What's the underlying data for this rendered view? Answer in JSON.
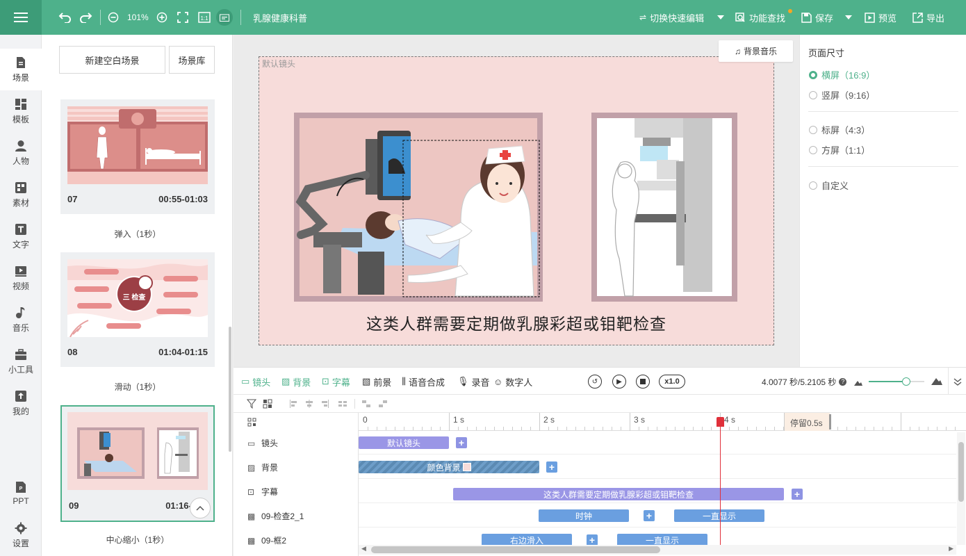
{
  "toolbar": {
    "zoom": "101%",
    "project_title": "乳腺健康科普",
    "quick_edit": "切换快速编辑",
    "func_search": "功能查找",
    "save": "保存",
    "preview": "预览",
    "export": "导出"
  },
  "nav": [
    {
      "label": "场景",
      "icon": "scene-icon"
    },
    {
      "label": "模板",
      "icon": "template-icon"
    },
    {
      "label": "人物",
      "icon": "person-icon"
    },
    {
      "label": "素材",
      "icon": "material-icon"
    },
    {
      "label": "文字",
      "icon": "text-icon"
    },
    {
      "label": "视频",
      "icon": "video-icon"
    },
    {
      "label": "音乐",
      "icon": "music-icon"
    },
    {
      "label": "小工具",
      "icon": "toolbox-icon"
    },
    {
      "label": "我的",
      "icon": "upload-icon"
    },
    {
      "label": "PPT",
      "icon": "ppt-icon"
    },
    {
      "label": "设置",
      "icon": "gear-icon"
    }
  ],
  "scene_panel": {
    "new_blank": "新建空白场景",
    "library": "场景库",
    "scenes": [
      {
        "num": "07",
        "time": "00:55-01:03",
        "transition": "弹入（1秒）"
      },
      {
        "num": "08",
        "time": "01:04-01:15",
        "transition": "滑动（1秒）",
        "thumb_title": "三 检查"
      },
      {
        "num": "09",
        "time": "01:16-0",
        "transition": "中心缩小（1秒）"
      }
    ]
  },
  "canvas": {
    "stage_label": "默认镜头",
    "bgm_button": "背景音乐",
    "subtitle": "这类人群需要定期做乳腺彩超或钼靶检查"
  },
  "right_panel": {
    "title": "页面尺寸",
    "options": [
      {
        "label": "横屏（16:9）",
        "selected": true
      },
      {
        "label": "竖屏（9:16）",
        "selected": false
      },
      {
        "label": "标屏（4:3）",
        "selected": false
      },
      {
        "label": "方屏（1:1）",
        "selected": false
      },
      {
        "label": "自定义",
        "selected": false
      }
    ]
  },
  "timeline": {
    "tabs": [
      "镜头",
      "背景",
      "字幕",
      "前景",
      "语音合成",
      "录音",
      "数字人"
    ],
    "speed": "x1.0",
    "time_info": "4.0077 秒/5.2105 秒",
    "ruler": [
      "0",
      "1 s",
      "2 s",
      "3 s",
      "4 s"
    ],
    "pause_label": "停留0.5s",
    "tracks": [
      {
        "label": "镜头",
        "icon": "camera-icon",
        "clips": [
          "默认镜头"
        ]
      },
      {
        "label": "背景",
        "icon": "background-icon",
        "clips": [
          "颜色背景"
        ]
      },
      {
        "label": "字幕",
        "icon": "subtitle-icon",
        "clips": [
          "这类人群需要定期做乳腺彩超或钼靶检查"
        ]
      },
      {
        "label": "09-检查2_1",
        "icon": "image-icon",
        "clips": [
          "时钟",
          "一直显示"
        ]
      },
      {
        "label": "09-框2",
        "icon": "image-icon",
        "clips": [
          "右边滑入",
          "一直显示"
        ]
      }
    ]
  },
  "colors": {
    "brand": "#4eb18b",
    "stage_bg": "#f7dcda",
    "playhead": "#e0303a",
    "clip_purple": "#9a96e6",
    "clip_blue": "#6a9fe0"
  }
}
